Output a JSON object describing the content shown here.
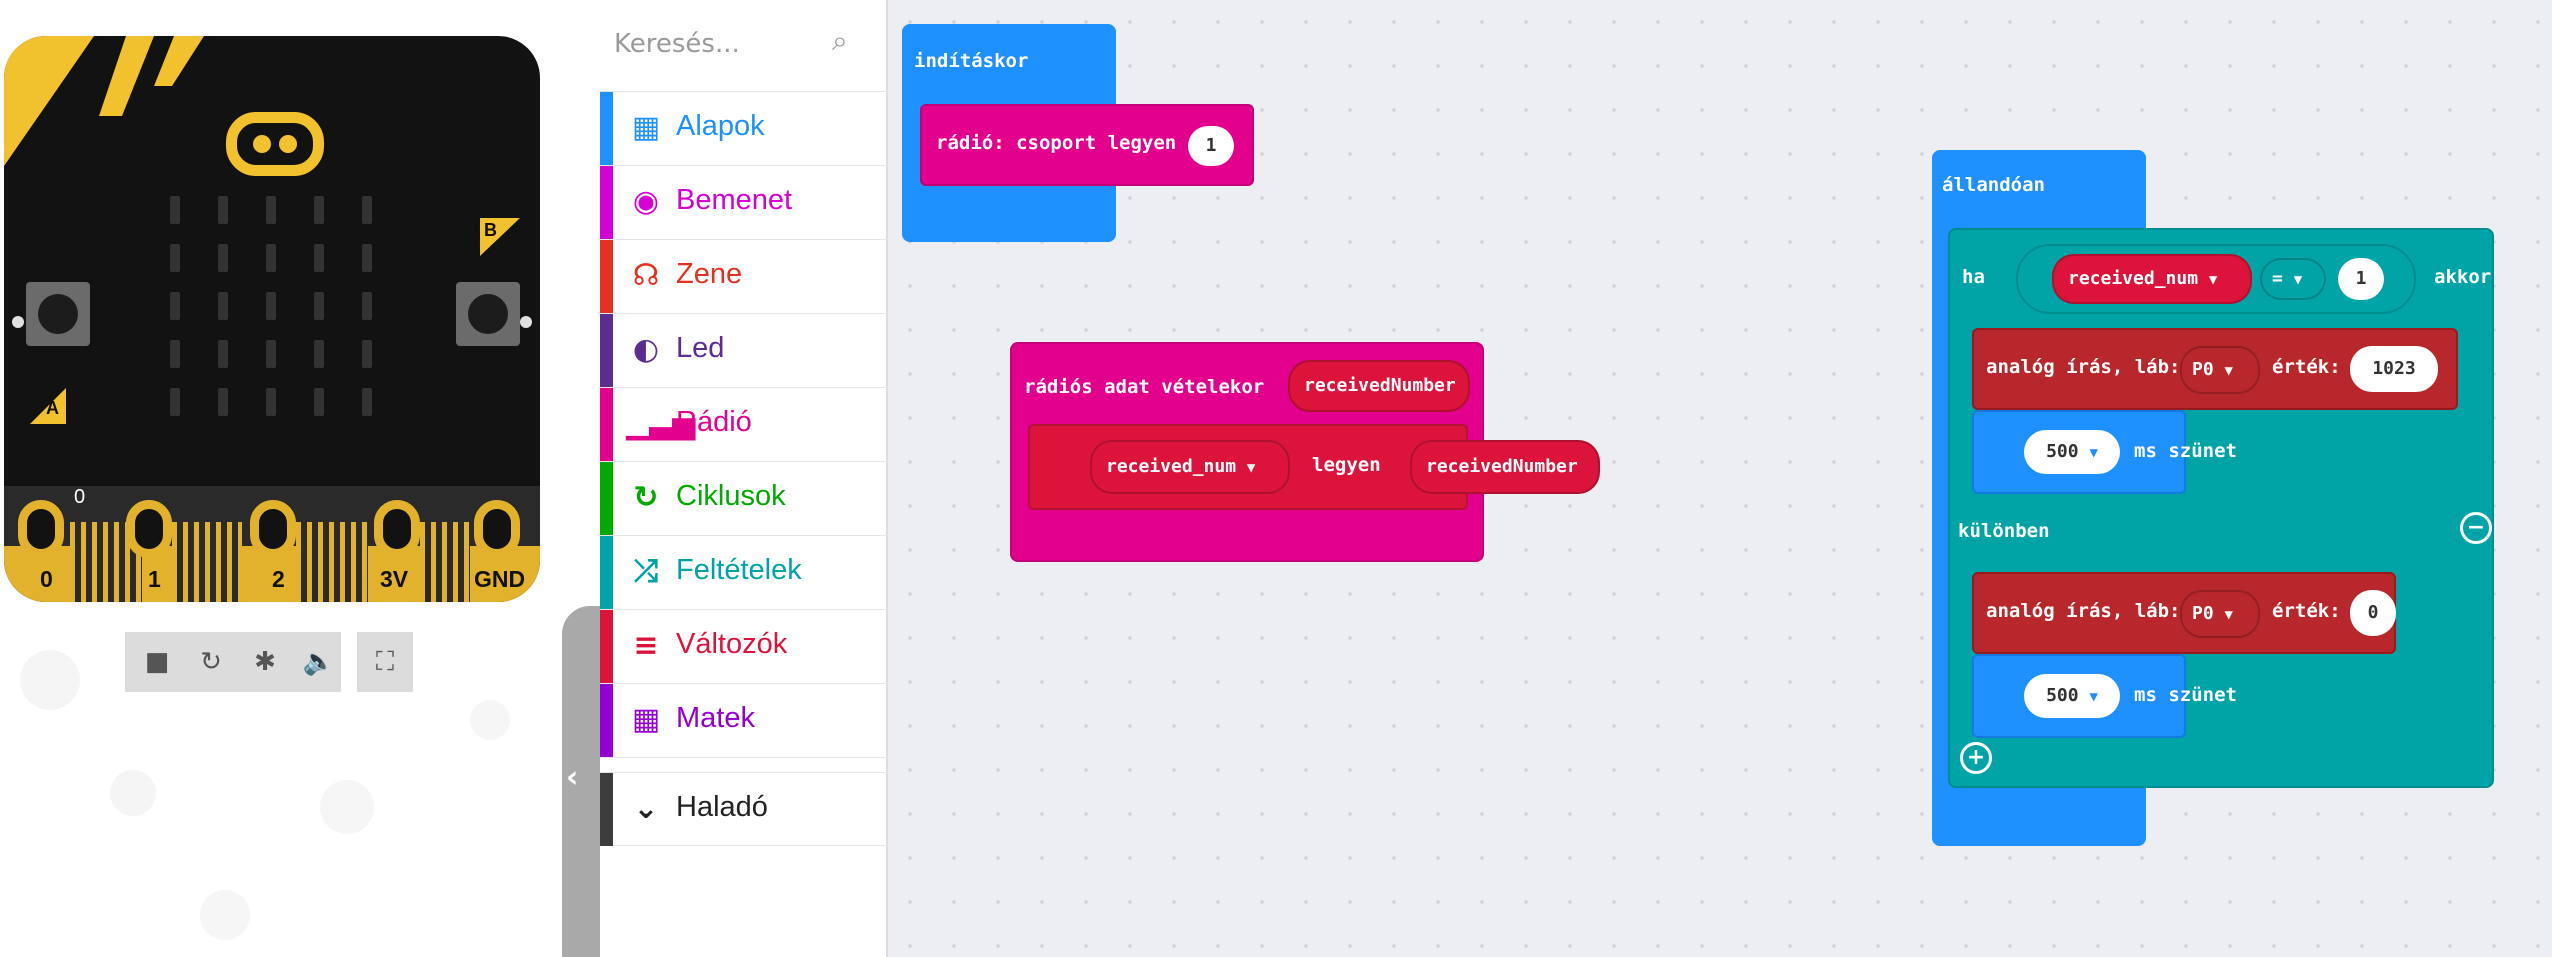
{
  "simulator": {
    "pin_labels": [
      "0",
      "1",
      "2",
      "3V",
      "GND"
    ],
    "pin0_value": "0",
    "button_a": "A",
    "button_b": "B",
    "controls": [
      "stop-icon",
      "restart-icon",
      "debug-icon",
      "sound-icon",
      "fullscreen-icon"
    ]
  },
  "toolbox": {
    "search_placeholder": "Keresés...",
    "categories": [
      {
        "label": "Alapok",
        "icon": "grid-icon",
        "color": "#1e90ff"
      },
      {
        "label": "Bemenet",
        "icon": "target-icon",
        "color": "#d400d4"
      },
      {
        "label": "Zene",
        "icon": "headphones-icon",
        "color": "#e63022"
      },
      {
        "label": "Led",
        "icon": "toggle-icon",
        "color": "#5c2d91"
      },
      {
        "label": "Rádió",
        "icon": "signal-bars-icon",
        "color": "#e3008c"
      },
      {
        "label": "Ciklusok",
        "icon": "refresh-icon",
        "color": "#00aa00"
      },
      {
        "label": "Feltételek",
        "icon": "shuffle-icon",
        "color": "#00a4a6"
      },
      {
        "label": "Változók",
        "icon": "lines-icon",
        "color": "#dc143c"
      },
      {
        "label": "Matek",
        "icon": "calculator-icon",
        "color": "#9400d3"
      },
      {
        "label": "Haladó",
        "icon": "chevron-down-icon",
        "color": "#3c3c3c"
      }
    ]
  },
  "workspace": {
    "on_start": {
      "header": "indításkor",
      "radio_group_label": "rádió: csoport legyen",
      "radio_group_value": "1"
    },
    "on_radio": {
      "header": "rádiós adat vételekor",
      "param": "receivedNumber",
      "set_var": "received_num",
      "set_label": "legyen",
      "set_value": "receivedNumber"
    },
    "forever": {
      "header": "állandóan",
      "if_label": "ha",
      "then_label": "akkor",
      "cond_var": "received_num",
      "cond_op": "=",
      "cond_value": "1",
      "write1_label": "analóg írás, láb:",
      "write1_pin": "P0",
      "write1_value_label": "érték:",
      "write1_value": "1023",
      "pause1_value": "500",
      "pause_label": "ms szünet",
      "else_label": "különben",
      "write2_label": "analóg írás, láb:",
      "write2_pin": "P0",
      "write2_value_label": "érték:",
      "write2_value": "0",
      "pause2_value": "500"
    }
  },
  "colors": {
    "basic": "#1e90ff",
    "radio": "#e3008c",
    "logic": "#00a4a6",
    "pins": "#b8272c",
    "variables": "#dc143c",
    "board_yellow": "#f2c12e"
  }
}
